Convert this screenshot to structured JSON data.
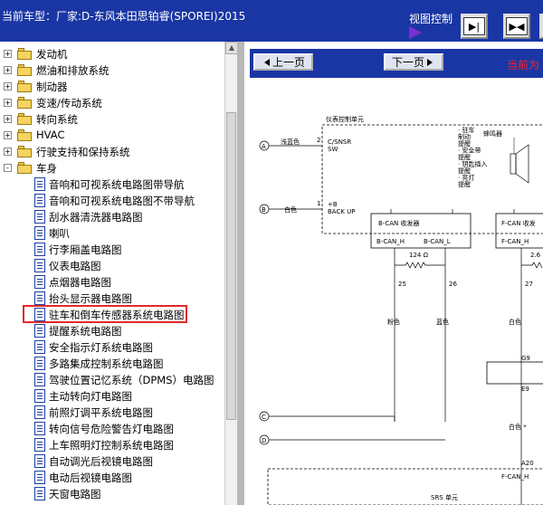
{
  "topbar": {
    "title": "当前车型：厂家:D-东风本田思铂睿(SPOREI)2015",
    "view_control": "视图控制",
    "buttons": [
      "▶|",
      "▶|◀"
    ]
  },
  "tree": {
    "top_items": [
      {
        "label": "发动机",
        "state": "+"
      },
      {
        "label": "燃油和排放系统",
        "state": "+"
      },
      {
        "label": "制动器",
        "state": "+"
      },
      {
        "label": "变速/传动系统",
        "state": "+"
      },
      {
        "label": "转向系统",
        "state": "+"
      },
      {
        "label": "HVAC",
        "state": "+"
      },
      {
        "label": "行驶支持和保持系统",
        "state": "+"
      },
      {
        "label": "车身",
        "state": "-"
      }
    ],
    "children": [
      "音响和可视系统电路图带导航",
      "音响和可视系统电路图不带导航",
      "刮水器清洗器电路图",
      "喇叭",
      "行李厢盖电路图",
      "仪表电路图",
      "点烟器电路图",
      "抬头显示器电路图",
      "驻车和倒车传感器系统电路图",
      "提醒系统电路图",
      "安全指示灯系统电路图",
      "多路集成控制系统电路图",
      "驾驶位置记忆系统（DPMS）电路图",
      "主动转向灯电路图",
      "前照灯调平系统电路图",
      "转向信号危险警告灯电路图",
      "上车照明灯控制系统电路图",
      "自动调光后视镜电路图",
      "电动后视镜电路图",
      "天窗电路图"
    ]
  },
  "nav": {
    "prev": "上一页",
    "next": "下一页",
    "current": "当前为"
  },
  "diagram": {
    "unit_title": "仪表控制单元",
    "conn_a": "A",
    "conn_b": "B",
    "conn_c": "C",
    "conn_d": "D",
    "wire_a": "浅蓝色",
    "wire_b": "白色",
    "pin2": "2",
    "pin1": "1",
    "csnsr": "C/SNSR",
    "sw": "SW",
    "plusb": "+B",
    "backup": "BACK UP",
    "notes": [
      "· 驻车",
      "制动",
      "提醒",
      "· 安全带",
      "提醒",
      "· 钥匙插入",
      "提醒",
      "· 亮灯",
      "提醒"
    ],
    "buzzer": "蜂鸣器",
    "bcan": "B-CAN 收发器",
    "bcan_h": "B-CAN_H",
    "bcan_l": "B-CAN_L",
    "fcan": "F-CAN 收发",
    "fcan_h": "F-CAN_H",
    "r1": "124 Ω",
    "r2": "2.6",
    "p25": "25",
    "p26": "26",
    "p27": "27",
    "w25": "粉色",
    "w26": "蓝色",
    "w27": "白色",
    "g9": "G9",
    "e9": "E9",
    "white_star": "白色 *",
    "a20": "A20",
    "fcan_h2": "F-CAN_H",
    "srs": "SRS 单元"
  }
}
